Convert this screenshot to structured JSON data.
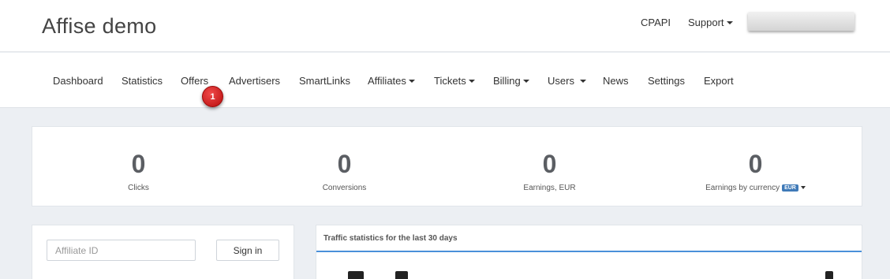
{
  "header": {
    "brand": "Affise demo",
    "links": {
      "cpapi": "CPAPI",
      "support": "Support"
    }
  },
  "nav": {
    "dashboard": "Dashboard",
    "statistics": "Statistics",
    "offers": "Offers",
    "advertisers": "Advertisers",
    "smartlinks": "SmartLinks",
    "affiliates": "Affiliates",
    "tickets": "Tickets",
    "billing": "Billing",
    "users": "Users",
    "news": "News",
    "settings": "Settings",
    "export": "Export"
  },
  "annotation": {
    "step": "1"
  },
  "stats": {
    "clicks": {
      "value": "0",
      "label": "Clicks"
    },
    "conversions": {
      "value": "0",
      "label": "Conversions"
    },
    "earnings": {
      "value": "0",
      "label": "Earnings, EUR"
    },
    "earnings_by_currency": {
      "value": "0",
      "label": "Earnings by currency",
      "currency": "EUR"
    }
  },
  "login": {
    "placeholder": "Affiliate ID",
    "button": "Sign in"
  },
  "traffic": {
    "title": "Traffic statistics for the last 30 days"
  },
  "colors": {
    "accent": "#4a90d9",
    "badge": "#d21818",
    "currency_badge": "#3f7ab8",
    "background": "#eceff3"
  }
}
